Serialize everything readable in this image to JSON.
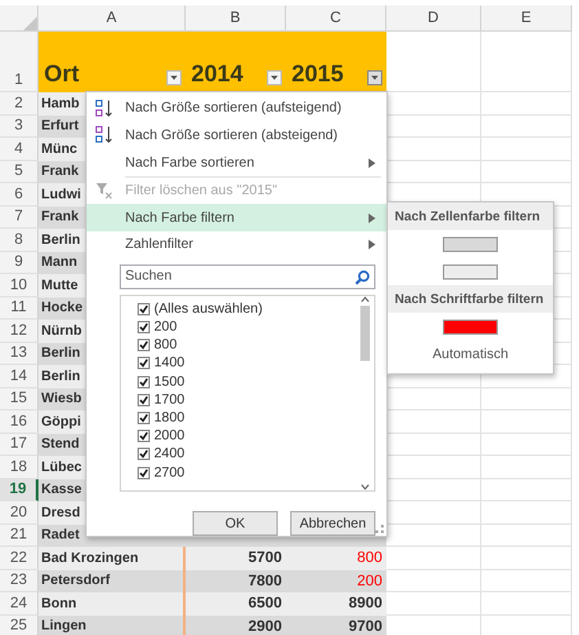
{
  "sheet": {
    "columns": [
      "A",
      "B",
      "C",
      "D",
      "E"
    ],
    "header": {
      "number": "1",
      "cells": [
        {
          "text": "Ort",
          "selected": false
        },
        {
          "text": "2014",
          "selected": false
        },
        {
          "text": "2015",
          "selected": true
        }
      ]
    },
    "rows": [
      {
        "number": "2",
        "selected": false,
        "cells": [
          {
            "text": "Hamb"
          },
          {
            "text": ""
          },
          {
            "text": ""
          }
        ]
      },
      {
        "number": "3",
        "selected": false,
        "cells": [
          {
            "text": "Erfurt"
          },
          {
            "text": ""
          },
          {
            "text": ""
          }
        ]
      },
      {
        "number": "4",
        "selected": false,
        "cells": [
          {
            "text": "Münc"
          },
          {
            "text": ""
          },
          {
            "text": ""
          }
        ]
      },
      {
        "number": "5",
        "selected": false,
        "cells": [
          {
            "text": "Frank"
          },
          {
            "text": ""
          },
          {
            "text": ""
          }
        ]
      },
      {
        "number": "6",
        "selected": false,
        "cells": [
          {
            "text": "Ludwi"
          },
          {
            "text": ""
          },
          {
            "text": ""
          }
        ]
      },
      {
        "number": "7",
        "selected": false,
        "cells": [
          {
            "text": "Frank"
          },
          {
            "text": ""
          },
          {
            "text": ""
          }
        ]
      },
      {
        "number": "8",
        "selected": false,
        "cells": [
          {
            "text": "Berlin"
          },
          {
            "text": ""
          },
          {
            "text": ""
          }
        ]
      },
      {
        "number": "9",
        "selected": false,
        "cells": [
          {
            "text": "Mann"
          },
          {
            "text": ""
          },
          {
            "text": ""
          }
        ]
      },
      {
        "number": "10",
        "selected": false,
        "cells": [
          {
            "text": "Mutte"
          },
          {
            "text": ""
          },
          {
            "text": ""
          }
        ]
      },
      {
        "number": "11",
        "selected": false,
        "cells": [
          {
            "text": "Hocke"
          },
          {
            "text": ""
          },
          {
            "text": ""
          }
        ]
      },
      {
        "number": "12",
        "selected": false,
        "cells": [
          {
            "text": "Nürnb"
          },
          {
            "text": ""
          },
          {
            "text": ""
          }
        ]
      },
      {
        "number": "13",
        "selected": false,
        "cells": [
          {
            "text": "Berlin"
          },
          {
            "text": ""
          },
          {
            "text": ""
          }
        ]
      },
      {
        "number": "14",
        "selected": false,
        "cells": [
          {
            "text": "Berlin"
          },
          {
            "text": ""
          },
          {
            "text": ""
          }
        ]
      },
      {
        "number": "15",
        "selected": false,
        "cells": [
          {
            "text": "Wiesb"
          },
          {
            "text": ""
          },
          {
            "text": ""
          }
        ]
      },
      {
        "number": "16",
        "selected": false,
        "cells": [
          {
            "text": "Göppi"
          },
          {
            "text": ""
          },
          {
            "text": ""
          }
        ]
      },
      {
        "number": "17",
        "selected": false,
        "cells": [
          {
            "text": "Stend"
          },
          {
            "text": ""
          },
          {
            "text": ""
          }
        ]
      },
      {
        "number": "18",
        "selected": false,
        "cells": [
          {
            "text": "Lübec"
          },
          {
            "text": ""
          },
          {
            "text": ""
          }
        ]
      },
      {
        "number": "19",
        "selected": true,
        "cells": [
          {
            "text": "Kasse"
          },
          {
            "text": ""
          },
          {
            "text": ""
          }
        ]
      },
      {
        "number": "20",
        "selected": false,
        "cells": [
          {
            "text": "Dresd"
          },
          {
            "text": ""
          },
          {
            "text": ""
          }
        ]
      },
      {
        "number": "21",
        "selected": false,
        "cells": [
          {
            "text": "Radet"
          },
          {
            "text": ""
          },
          {
            "text": ""
          }
        ]
      },
      {
        "number": "22",
        "selected": false,
        "cells": [
          {
            "text": "Bad Krozingen"
          },
          {
            "text": "5700"
          },
          {
            "text": "800",
            "color": "#ff0000"
          }
        ]
      },
      {
        "number": "23",
        "selected": false,
        "cells": [
          {
            "text": "Petersdorf"
          },
          {
            "text": "7800"
          },
          {
            "text": "200",
            "color": "#ff0000"
          }
        ]
      },
      {
        "number": "24",
        "selected": false,
        "cells": [
          {
            "text": "Bonn"
          },
          {
            "text": "6500"
          },
          {
            "text": "8900"
          }
        ]
      },
      {
        "number": "25",
        "selected": false,
        "cells": [
          {
            "text": "Lingen"
          },
          {
            "text": "2900"
          },
          {
            "text": "9700"
          }
        ]
      }
    ]
  },
  "filter_menu": {
    "items": [
      {
        "kind": "sort-asc",
        "label": "Nach Größe sortieren (aufsteigend)",
        "submenu": false,
        "disabled": false,
        "highlighted": false
      },
      {
        "kind": "sort-desc",
        "label": "Nach Größe sortieren (absteigend)",
        "submenu": false,
        "disabled": false,
        "highlighted": false
      },
      {
        "kind": "plain",
        "label": "Nach Farbe sortieren",
        "submenu": true,
        "disabled": false,
        "highlighted": false
      },
      {
        "kind": "clear-filter",
        "label": "Filter löschen aus \"2015\"",
        "submenu": false,
        "disabled": true,
        "highlighted": false
      },
      {
        "kind": "plain",
        "label": "Nach Farbe filtern",
        "submenu": true,
        "disabled": false,
        "highlighted": true
      },
      {
        "kind": "plain",
        "label": "Zahlenfilter",
        "submenu": true,
        "disabled": false,
        "highlighted": false
      }
    ],
    "search": {
      "placeholder": "Suchen"
    },
    "values": [
      {
        "label": "(Alles auswählen)",
        "checked": true
      },
      {
        "label": "200",
        "checked": true
      },
      {
        "label": "800",
        "checked": true
      },
      {
        "label": "1400",
        "checked": true
      },
      {
        "label": "1500",
        "checked": true
      },
      {
        "label": "1700",
        "checked": true
      },
      {
        "label": "1800",
        "checked": true
      },
      {
        "label": "2000",
        "checked": true
      },
      {
        "label": "2400",
        "checked": true
      },
      {
        "label": "2700",
        "checked": true
      }
    ],
    "buttons": [
      "OK",
      "Abbrechen"
    ]
  },
  "color_submenu": {
    "items": [
      {
        "kind": "header",
        "label": "Nach Zellenfarbe filtern"
      },
      {
        "kind": "swatch",
        "color": "#d9d9d9"
      },
      {
        "kind": "swatch",
        "color": "#ededed"
      },
      {
        "kind": "header",
        "label": "Nach Schriftfarbe filtern"
      },
      {
        "kind": "swatch",
        "color": "#ff0000"
      },
      {
        "kind": "text",
        "label": "Automatisch"
      }
    ]
  }
}
